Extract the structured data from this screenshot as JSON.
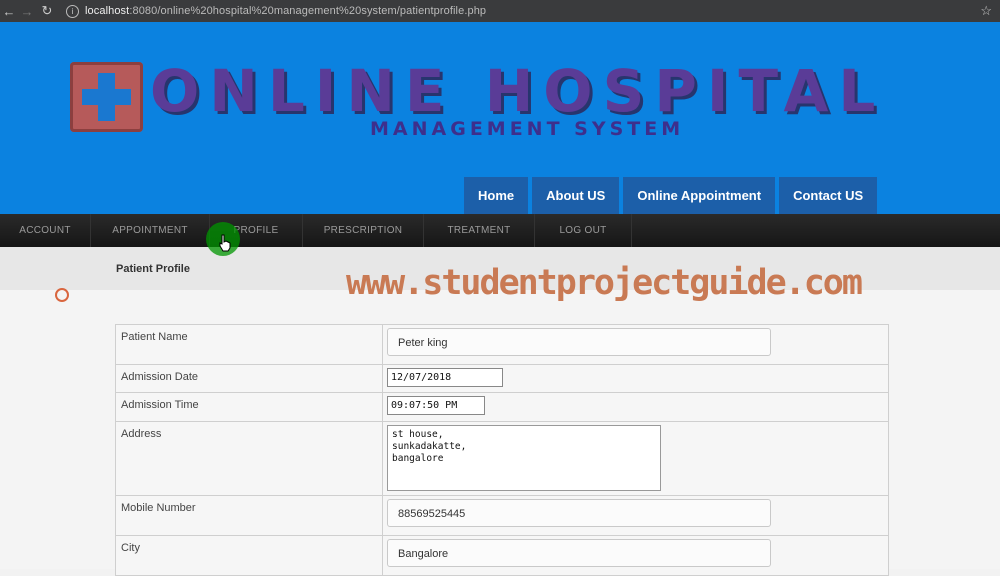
{
  "browser": {
    "url_host": "localhost",
    "url_rest": ":8080/online%20hospital%20management%20system/patientprofile.php"
  },
  "banner": {
    "title": "ONLINE HOSPITAL",
    "subtitle": "MANAGEMENT SYSTEM",
    "bg_color": "#0b82e0"
  },
  "top_nav": [
    "Home",
    "About US",
    "Online Appointment",
    "Contact US"
  ],
  "menu": [
    "ACCOUNT",
    "APPOINTMENT",
    "PROFILE",
    "PRESCRIPTION",
    "TREATMENT",
    "LOG OUT"
  ],
  "section_title": "Patient Profile",
  "watermark": "www.studentprojectguide.com",
  "form": {
    "patient_name_label": "Patient Name",
    "patient_name": "Peter king",
    "admission_date_label": "Admission Date",
    "admission_date": "12/07/2018",
    "admission_time_label": "Admission Time",
    "admission_time": "09:07:50 PM",
    "address_label": "Address",
    "address": "st house,\nsunkadakatte,\nbangalore",
    "mobile_label": "Mobile Number",
    "mobile": "88569525445",
    "city_label": "City",
    "city": "Bangalore"
  }
}
